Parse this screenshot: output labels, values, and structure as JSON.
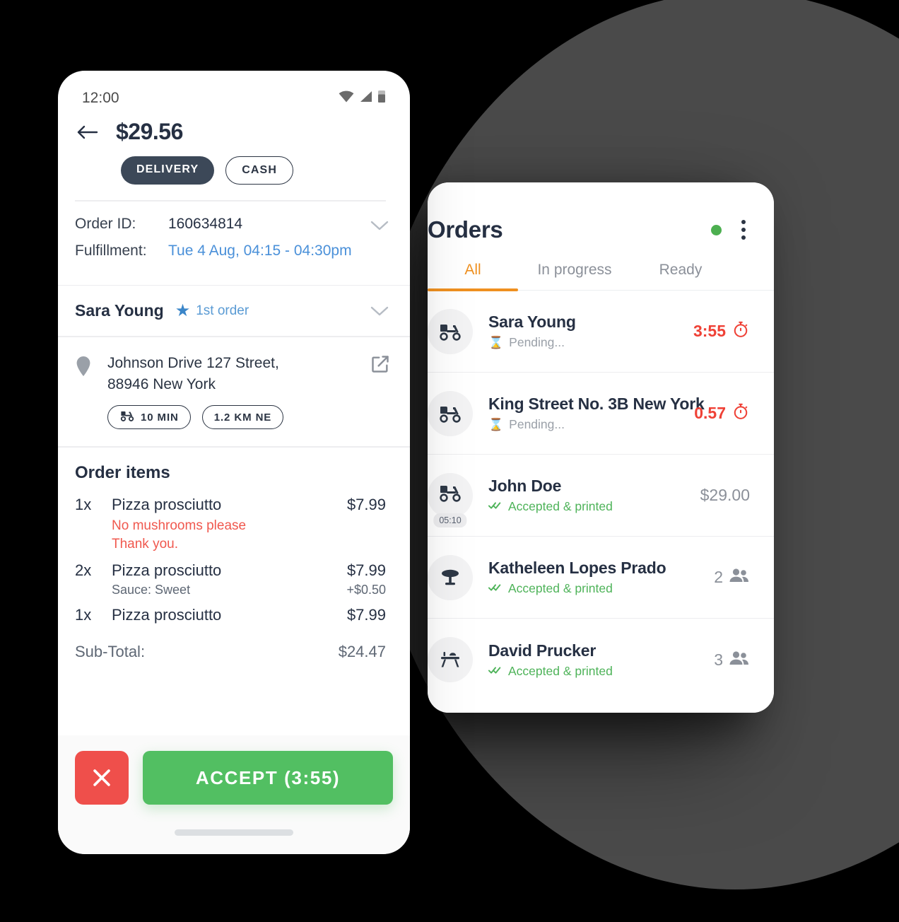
{
  "phone": {
    "statusbar": {
      "time": "12:00",
      "icons": [
        "wifi-icon",
        "cellular-signal-icon",
        "battery-icon"
      ]
    },
    "header": {
      "back_icon": "back-arrow-icon",
      "amount": "$29.56",
      "chips": [
        {
          "label": "DELIVERY",
          "style": "solid"
        },
        {
          "label": "CASH",
          "style": "outline"
        }
      ]
    },
    "meta": {
      "order_id_label": "Order ID:",
      "order_id_value": "160634814",
      "fulfillment_label": "Fulfillment:",
      "fulfillment_value": "Tue 4 Aug, 04:15 - 04:30pm",
      "expand_icon": "chevron-down-icon"
    },
    "customer": {
      "name": "Sara Young",
      "star_icon": "star-icon",
      "badge": "1st order",
      "expand_icon": "chevron-down-icon"
    },
    "address": {
      "pin_icon": "location-pin-icon",
      "line1": "Johnson Drive 127 Street,",
      "line2": "88946 New York",
      "external_icon": "external-link-icon",
      "pills": [
        {
          "icon": "scooter-icon",
          "label": "10 MIN"
        },
        {
          "icon": "",
          "label": "1.2 KM NE"
        }
      ]
    },
    "order_items": {
      "title": "Order items",
      "items": [
        {
          "qty": "1x",
          "name": "Pizza prosciutto",
          "price": "$7.99",
          "note": "No mushrooms please\nThank you."
        },
        {
          "qty": "2x",
          "name": "Pizza prosciutto",
          "price": "$7.99",
          "option_name": "Sauce: Sweet",
          "option_price": "+$0.50"
        },
        {
          "qty": "1x",
          "name": "Pizza prosciutto",
          "price": "$7.99"
        }
      ],
      "subtotal_label": "Sub-Total:",
      "subtotal_value": "$24.47"
    },
    "actions": {
      "cancel_icon": "close-icon",
      "accept_label": "ACCEPT (3:55)"
    }
  },
  "tablet": {
    "title": "Orders",
    "status_dot_icon": "online-status-dot",
    "status_dot_color": "#4CAF50",
    "menu_icon": "kebab-menu-icon",
    "tabs": [
      {
        "label": "All",
        "active": true
      },
      {
        "label": "In progress",
        "active": false
      },
      {
        "label": "Ready",
        "active": false
      }
    ],
    "rows": [
      {
        "icon": "scooter-icon",
        "name": "Sara Young",
        "status_icon": "hourglass-icon",
        "status": "Pending...",
        "status_type": "pending",
        "right_value": "3:55",
        "right_icon": "stopwatch-icon",
        "right_type": "timer"
      },
      {
        "icon": "scooter-icon",
        "name": "King Street No. 3B New York",
        "status_icon": "hourglass-icon",
        "status": "Pending...",
        "status_type": "pending",
        "right_value": "0.57",
        "right_icon": "stopwatch-icon",
        "right_type": "timer"
      },
      {
        "icon": "scooter-icon",
        "badge": "05:10",
        "name": "John Doe",
        "status_icon": "double-check-icon",
        "status": "Accepted & printed",
        "status_type": "accepted",
        "right_value": "$29.00",
        "right_icon": "",
        "right_type": "money"
      },
      {
        "icon": "dining-table-icon",
        "name": "Katheleen Lopes Prado",
        "status_icon": "double-check-icon",
        "status": "Accepted & printed",
        "status_type": "accepted",
        "right_value": "2",
        "right_icon": "people-icon",
        "right_type": "guests"
      },
      {
        "icon": "picnic-table-icon",
        "name": "David Prucker",
        "status_icon": "double-check-icon",
        "status": "Accepted & printed",
        "status_type": "accepted",
        "right_value": "3",
        "right_icon": "people-icon",
        "right_type": "guests"
      }
    ]
  },
  "theme": {
    "accent_orange": "#ef9020",
    "accept_green": "#52bf62",
    "cancel_red": "#ef4f4b",
    "timer_red": "#ef4136",
    "link_blue": "#4a90d9",
    "dark": "#263043",
    "bg_circle": "#4a4a4a"
  }
}
